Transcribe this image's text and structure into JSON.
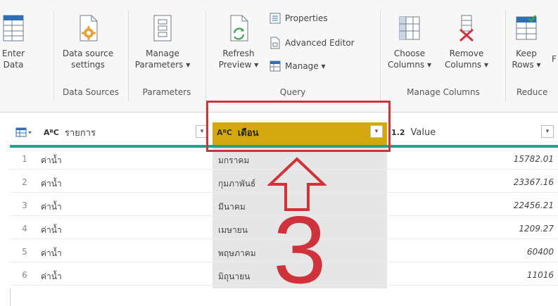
{
  "ribbon": {
    "enter_data": {
      "line1": "Enter",
      "line2": "Data"
    },
    "data_source_settings": {
      "line1": "Data source",
      "line2": "settings"
    },
    "manage_parameters": {
      "line1": "Manage",
      "line2": "Parameters ▾"
    },
    "refresh_preview": {
      "line1": "Refresh",
      "line2": "Preview ▾"
    },
    "properties": "Properties",
    "advanced_editor": "Advanced Editor",
    "manage": "Manage ▾",
    "choose_columns": {
      "line1": "Choose",
      "line2": "Columns ▾"
    },
    "remove_columns": {
      "line1": "Remove",
      "line2": "Columns ▾"
    },
    "keep_rows": {
      "line1": "Keep",
      "line2": "Rows ▾"
    },
    "f_cut": "F",
    "groups": {
      "data_sources": "Data Sources",
      "parameters": "Parameters",
      "query": "Query",
      "manage_columns": "Manage Columns",
      "reduce": "Reduce"
    }
  },
  "grid": {
    "columns": [
      {
        "type": "AᴮC",
        "name": "รายการ"
      },
      {
        "type": "AᴮC",
        "name": "เดือน"
      },
      {
        "type": "1.2",
        "name": "Value"
      }
    ],
    "rows": [
      {
        "n": "1",
        "item": "ค่าน้ำ",
        "month": "มกราคม",
        "value": "15782.01"
      },
      {
        "n": "2",
        "item": "ค่าน้ำ",
        "month": "กุมภาพันธ์",
        "value": "23367.16"
      },
      {
        "n": "3",
        "item": "ค่าน้ำ",
        "month": "มีนาคม",
        "value": "22456.21"
      },
      {
        "n": "4",
        "item": "ค่าน้ำ",
        "month": "เมษายน",
        "value": "1209.27"
      },
      {
        "n": "5",
        "item": "ค่าน้ำ",
        "month": "พฤษภาคม",
        "value": "60400"
      },
      {
        "n": "6",
        "item": "ค่าน้ำ",
        "month": "มิถุนายน",
        "value": "11016"
      }
    ]
  },
  "annotation": {
    "step_number": "3",
    "color": "#d0323c"
  },
  "colors": {
    "accent_teal": "#1fa38d",
    "selected_header": "#d4a90f",
    "annotation_red": "#d0323c"
  }
}
